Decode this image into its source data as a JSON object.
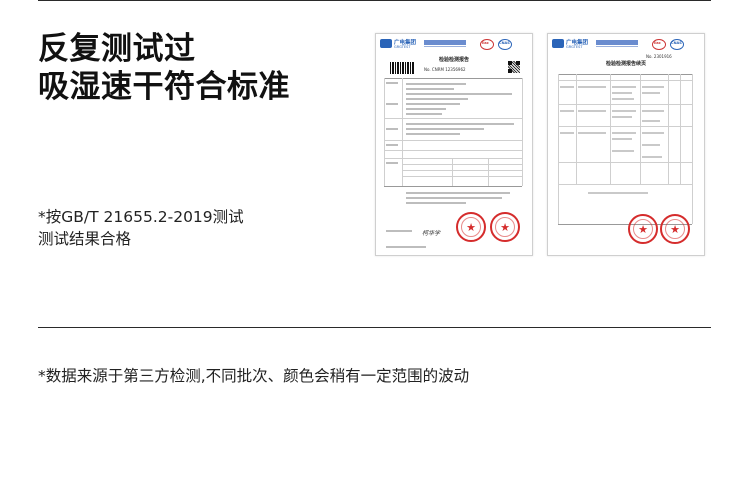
{
  "headline": {
    "line1": "反复测试过",
    "line2": "吸湿速干符合标准"
  },
  "test_note": {
    "line1": "*按GB/T 21655.2-2019测试",
    "line2": "测试结果合格"
  },
  "footer_note": "*数据来源于第三方检测,不同批次、颜色会稍有一定范围的波动",
  "documents": [
    {
      "title": "检验检测报告",
      "brand": "广电集团",
      "brand_sub": "GRGTEST",
      "report_no": "No. CNRM 12356962",
      "sig": "柯华学",
      "seals": [
        "★",
        "★"
      ],
      "cert_marks": [
        "ilac",
        "CNAS"
      ]
    },
    {
      "title": "检验检测报告续页",
      "brand": "广电集团",
      "brand_sub": "GRGTEST",
      "report_no": "No. 2301916",
      "seals": [
        "★",
        "★"
      ],
      "cert_marks": [
        "ilac",
        "CNAS"
      ]
    }
  ],
  "colors": {
    "brand_blue": "#2a64b8",
    "seal_red": "#d52c2c"
  }
}
